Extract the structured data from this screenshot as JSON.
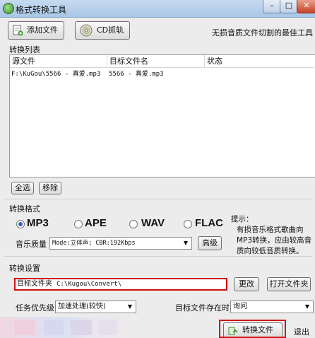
{
  "window": {
    "title": "格式转换工具",
    "min": "–",
    "max": "□",
    "close": "✕"
  },
  "toolbar": {
    "add_file": "添加文件",
    "cd_grab": "CD抓轨",
    "tagline": "无损音质文件切割的最佳工具"
  },
  "list": {
    "section_label": "转换列表",
    "columns": [
      "源文件",
      "目标文件名",
      "状态"
    ],
    "rows": [
      {
        "source": "F:\\KuGou\\5566 - 真爱.mp3",
        "target": "5566 - 真爱.mp3",
        "status": ""
      }
    ]
  },
  "list_buttons": {
    "select_all": "全选",
    "remove": "移除"
  },
  "format": {
    "section_label": "转换格式",
    "options": [
      "MP3",
      "APE",
      "WAV",
      "FLAC"
    ],
    "selected": "MP3",
    "quality_label": "音乐质量",
    "quality_value": "Mode:立体声; CBR:192Kbps",
    "advanced": "高级",
    "hint": "提示：\n有损音乐格式歌曲向MP3转换，应由较高音质向较低音质转换。"
  },
  "settings": {
    "section_label": "转换设置",
    "target_folder_label": "目标文件夹",
    "target_folder_value": "C:\\Kugou\\Convert\\",
    "change": "更改",
    "open_folder": "打开文件夹",
    "priority_label": "任务优先级",
    "priority_value": "加速处理(较快)",
    "exists_label": "目标文件存在时",
    "exists_value": "询问"
  },
  "actions": {
    "convert": "转换文件",
    "exit": "退出"
  }
}
